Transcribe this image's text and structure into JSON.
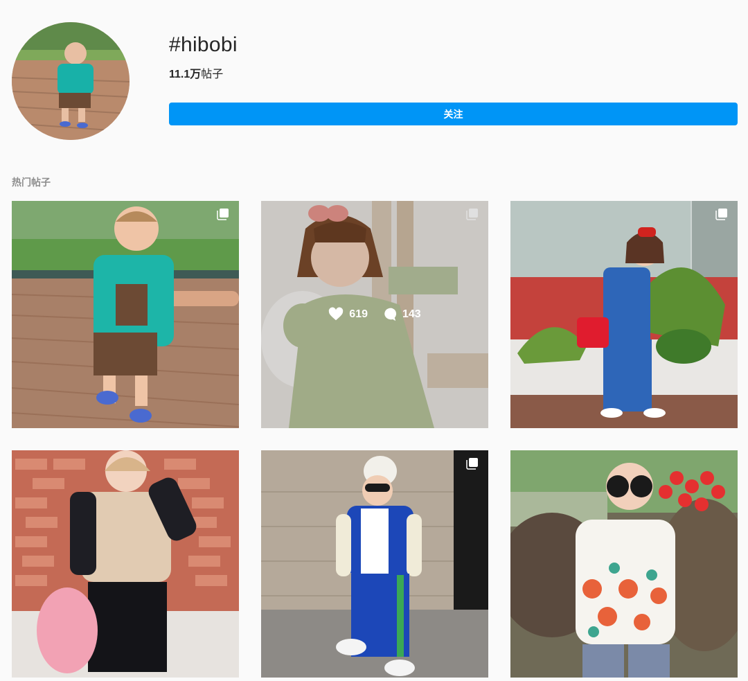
{
  "header": {
    "hashtag": "#hibobi",
    "post_count_value": "11.1万",
    "post_count_label": "帖子",
    "follow_label": "关注",
    "accent_color": "#0095f6"
  },
  "sections": {
    "top_posts_label": "热门帖子"
  },
  "posts": [
    {
      "subject": "toddler in teal t-shirt on wooden deck",
      "multi": true
    },
    {
      "subject": "girl with pink bow in sage green dress",
      "multi": true,
      "hovered": true,
      "likes": "619",
      "comments": "143"
    },
    {
      "subject": "girl in denim jumpsuit holding red bag",
      "multi": true
    },
    {
      "subject": "child in beige monogram jacket with pink balloon",
      "multi": false
    },
    {
      "subject": "boy in blue varsity jacket and white beanie",
      "multi": true
    },
    {
      "subject": "girl in floral dress with round sunglasses",
      "multi": false
    }
  ],
  "icons": {
    "multi": "carousel-icon",
    "like": "heart-icon",
    "comment": "speech-bubble-icon"
  }
}
